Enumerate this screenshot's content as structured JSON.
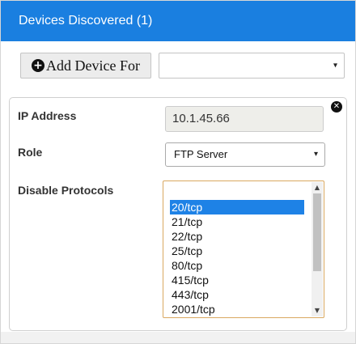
{
  "header": {
    "title": "Devices Discovered (1)"
  },
  "toolbar": {
    "add_device_label": "Add Device For",
    "plus_icon": "+",
    "device_select_value": "",
    "caret": "▾"
  },
  "device": {
    "ip_label": "IP Address",
    "ip_value": "10.1.45.66",
    "role_label": "Role",
    "role_value": "FTP Server",
    "protocols_label": "Disable Protocols",
    "close_icon": "✕",
    "protocols": [
      {
        "label": "20/tcp",
        "selected": true
      },
      {
        "label": "21/tcp",
        "selected": false
      },
      {
        "label": "22/tcp",
        "selected": false
      },
      {
        "label": "25/tcp",
        "selected": false
      },
      {
        "label": "80/tcp",
        "selected": false
      },
      {
        "label": "415/tcp",
        "selected": false
      },
      {
        "label": "443/tcp",
        "selected": false
      },
      {
        "label": "2001/tcp",
        "selected": false
      }
    ]
  },
  "scroll": {
    "up": "▲",
    "down": "▼"
  },
  "colors": {
    "header_bg": "#1a7fe0",
    "selected_bg": "#1e82e6",
    "listbox_border": "#d9a860"
  }
}
